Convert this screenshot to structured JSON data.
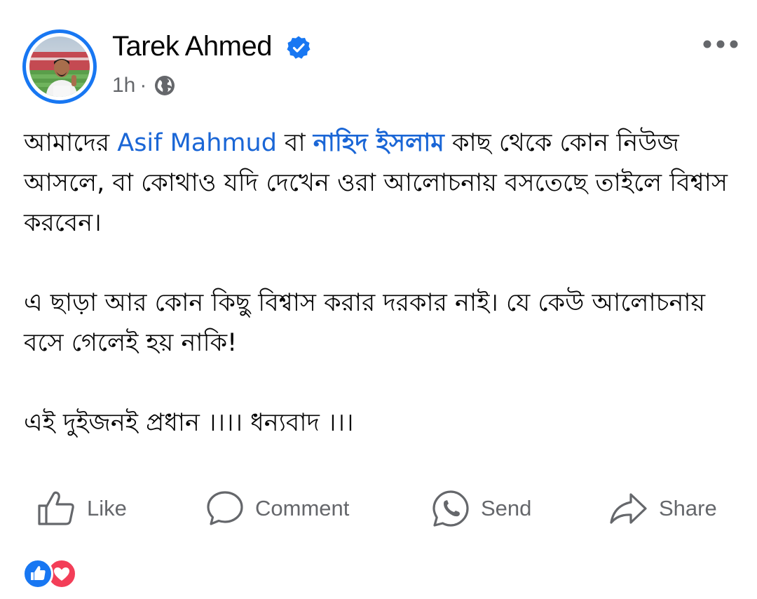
{
  "post": {
    "author": "Tarek Ahmed",
    "time": "1h",
    "meta_separator": "·",
    "verified_icon": "verified-badge-icon",
    "privacy_icon": "globe-icon",
    "more_icon": "more-options-icon",
    "body": {
      "p1_pre": "আমাদের ",
      "p1_mention1": "Asif Mahmud",
      "p1_mid": " বা ",
      "p1_mention2": "নাহিদ ইসলাম",
      "p1_post": " কাছ থেকে কোন নিউজ আসলে, বা কোথাও যদি দেখেন ওরা আলোচনায় বসতেছে তাইলে বিশ্বাস করবেন।",
      "p2": "এ ছাড়া আর কোন কিছু বিশ্বাস করার দরকার নাই। যে কেউ আলোচনায় বসে গেলেই হয় নাকি!",
      "p3": "এই দুইজনই প্রধান ।।।। ধন্যবাদ ।।।"
    }
  },
  "actions": {
    "like": "Like",
    "comment": "Comment",
    "send": "Send",
    "share": "Share"
  },
  "reactions": [
    "like",
    "love"
  ],
  "colors": {
    "accent": "#1877f2",
    "mention": "#1a66d6",
    "secondary_text": "#65676b",
    "love": "#f33e58"
  }
}
